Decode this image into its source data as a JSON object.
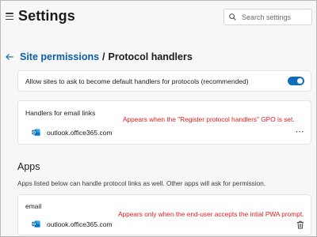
{
  "header": {
    "title": "Settings",
    "search_placeholder": "Search settings"
  },
  "breadcrumb": {
    "parent": "Site permissions",
    "separator": "/",
    "current": "Protocol handlers"
  },
  "toggle_setting": {
    "label": "Allow sites to ask to become default handlers for protocols (recommended)",
    "enabled": true
  },
  "email_handlers": {
    "heading": "Handlers for email links",
    "items": [
      {
        "name": "outlook.office365.com",
        "icon": "outlook-icon",
        "action_icon": "more-icon"
      }
    ]
  },
  "apps": {
    "title": "Apps",
    "description": "Apps listed below can handle protocol links as well. Other apps will ask for permission.",
    "heading": "email",
    "items": [
      {
        "name": "outlook.office365.com",
        "icon": "outlook-icon",
        "action_icon": "trash-icon"
      }
    ]
  },
  "annotations": {
    "gpo": "Appears when the \"Register protocol handlers\" GPO is set.",
    "pwa": "Appears only when the end-user accepts the intial PWA prompt."
  },
  "colors": {
    "accent": "#0f6cbd",
    "link": "#0a5ea8",
    "annotation": "#e02020"
  }
}
